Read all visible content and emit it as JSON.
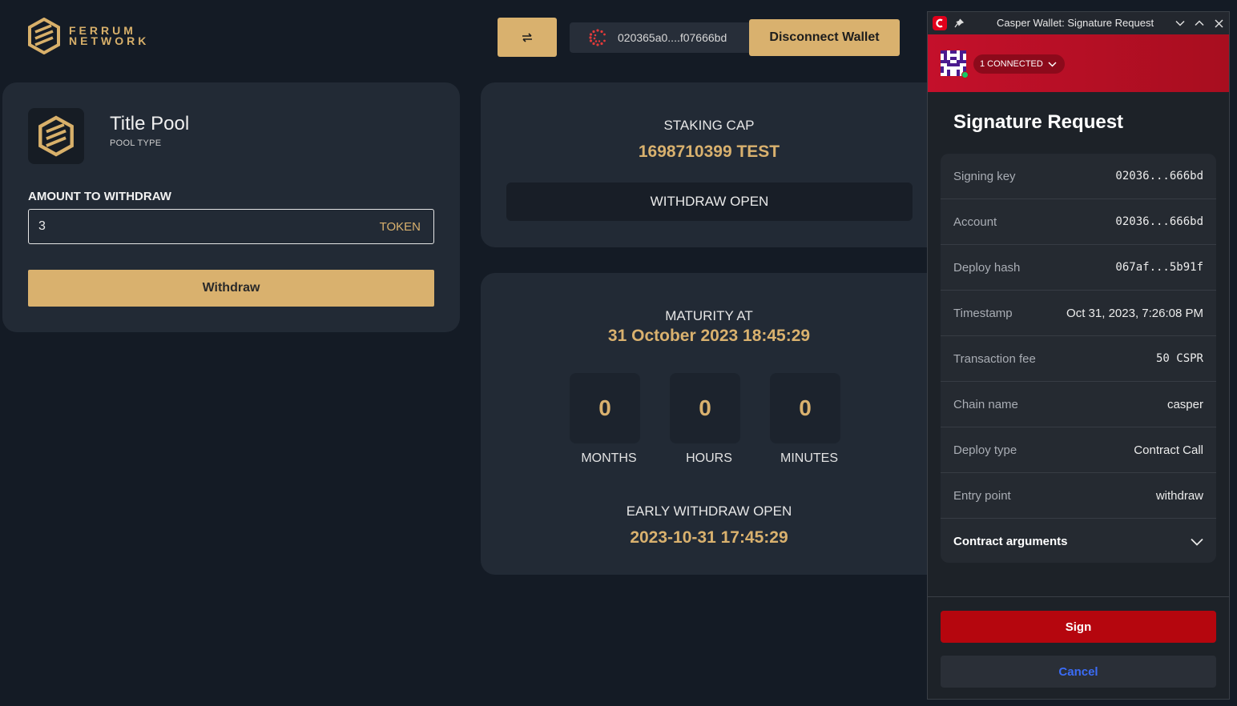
{
  "header": {
    "logo_line1": "FERRUM",
    "logo_line2": "NETWORK",
    "swap_icon": "swap-arrows-icon",
    "address": "020365a0....f07666bd",
    "disconnect_label": "Disconnect Wallet"
  },
  "pool": {
    "title": "Title Pool",
    "type_label": "POOL TYPE",
    "amount_label": "AMOUNT TO WITHDRAW",
    "amount_value": "3",
    "token_suffix": "TOKEN",
    "withdraw_label": "Withdraw"
  },
  "staking": {
    "cap_label": "STAKING CAP",
    "cap_value": "1698710399 TEST",
    "status": "WITHDRAW OPEN"
  },
  "maturity": {
    "label": "MATURITY AT",
    "value": "31 October 2023 18:45:29",
    "countdown": [
      {
        "value": "0",
        "label": "MONTHS"
      },
      {
        "value": "0",
        "label": "HOURS"
      },
      {
        "value": "0",
        "label": "MINUTES"
      }
    ],
    "early_label": "EARLY WITHDRAW OPEN",
    "early_value": "2023-10-31 17:45:29"
  },
  "wallet": {
    "window_title": "Casper Wallet: Signature Request",
    "connected_label": "1 CONNECTED",
    "heading": "Signature Request",
    "rows": [
      {
        "key": "Signing key",
        "value": "02036...666bd"
      },
      {
        "key": "Account",
        "value": "02036...666bd"
      },
      {
        "key": "Deploy hash",
        "value": "067af...5b91f"
      },
      {
        "key": "Timestamp",
        "value": "Oct 31, 2023, 7:26:08 PM"
      },
      {
        "key": "Transaction fee",
        "value": "50 CSPR"
      },
      {
        "key": "Chain name",
        "value": "casper"
      },
      {
        "key": "Deploy type",
        "value": "Contract Call"
      },
      {
        "key": "Entry point",
        "value": "withdraw"
      }
    ],
    "contract_args_label": "Contract arguments",
    "sign_label": "Sign",
    "cancel_label": "Cancel"
  },
  "colors": {
    "background": "#141b25",
    "card": "#222a35",
    "gold": "#d9b16e",
    "casper_red": "#c4102b",
    "cancel_blue": "#3b6cf6"
  }
}
